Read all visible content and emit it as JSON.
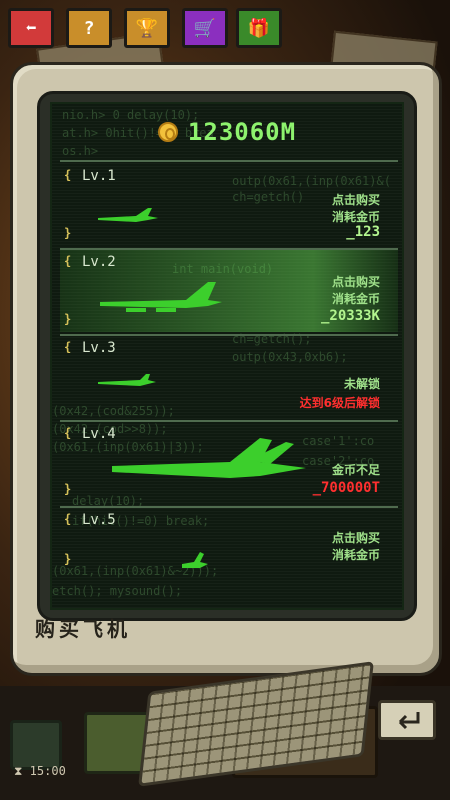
{
  "toolbar": {
    "buttons": [
      {
        "name": "back",
        "glyph": "⬅",
        "color": "#d23a3a"
      },
      {
        "name": "help",
        "glyph": "?",
        "color": "#c98e2a"
      },
      {
        "name": "trophy",
        "glyph": "🏆",
        "color": "#c98e2a"
      },
      {
        "name": "shop",
        "glyph": "🛒",
        "color": "#8b2fbf"
      },
      {
        "name": "gift",
        "glyph": "🎁",
        "color": "#3a8a2a"
      }
    ]
  },
  "coins": "123060M",
  "panel_title": "购买飞机",
  "planes": [
    {
      "level": "Lv.1",
      "line1": "点击购买",
      "line2": "消耗金币",
      "line3": "_123",
      "locked": false
    },
    {
      "level": "Lv.2",
      "line1": "点击购买",
      "line2": "消耗金币",
      "line3": "_20333K",
      "locked": false
    },
    {
      "level": "Lv.3",
      "line1": "未解锁",
      "line2": "达到6级后解锁",
      "line3": "",
      "locked": true
    },
    {
      "level": "Lv.4",
      "line1": "金币不足",
      "line2": "",
      "line3": "_700000T",
      "locked": false,
      "insufficient": true
    },
    {
      "level": "Lv.5",
      "line1": "点击购买",
      "line2": "消耗金币",
      "line3": "",
      "locked": false
    }
  ],
  "timer": "15:00",
  "colors": {
    "screen_text": "#9fe08a",
    "warning": "#ff2f2f",
    "coin": "#f2c13b"
  }
}
